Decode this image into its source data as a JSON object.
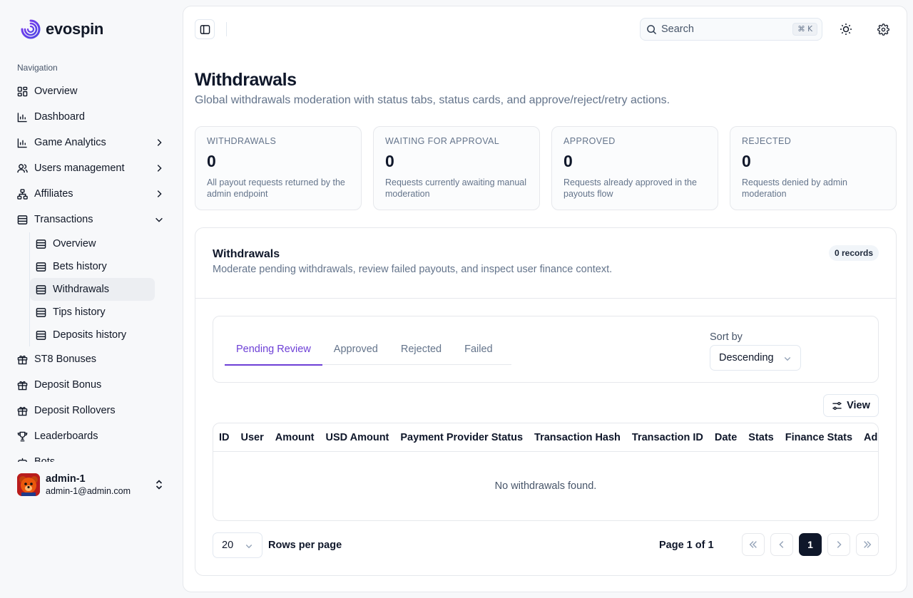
{
  "brand": {
    "name": "evospin"
  },
  "sidebar": {
    "heading": "Navigation",
    "items": [
      {
        "label": "Overview",
        "icon": "grid-icon"
      },
      {
        "label": "Dashboard",
        "icon": "chart-bar-icon"
      },
      {
        "label": "Game Analytics",
        "icon": "chart-bar-icon"
      },
      {
        "label": "Users management",
        "icon": "users-icon"
      },
      {
        "label": "Affiliates",
        "icon": "network-icon"
      },
      {
        "label": "Transactions",
        "icon": "archive-icon"
      }
    ],
    "sub_items": [
      {
        "label": "Overview"
      },
      {
        "label": "Bets history"
      },
      {
        "label": "Withdrawals"
      },
      {
        "label": "Tips history"
      },
      {
        "label": "Deposits history"
      }
    ],
    "more_items": [
      {
        "label": "ST8 Bonuses",
        "icon": "gift-icon"
      },
      {
        "label": "Deposit Bonus",
        "icon": "gift-icon"
      },
      {
        "label": "Deposit Rollovers",
        "icon": "gift-icon"
      },
      {
        "label": "Leaderboards",
        "icon": "trophy-icon"
      },
      {
        "label": "Bots",
        "icon": "bot-icon"
      }
    ],
    "user": {
      "name": "admin-1",
      "email": "admin-1@admin.com"
    }
  },
  "topbar": {
    "search_placeholder": "Search",
    "search_shortcut": "⌘ K"
  },
  "page": {
    "title": "Withdrawals",
    "description": "Global withdrawals moderation with status tabs, status cards, and approve/reject/retry actions."
  },
  "cards": [
    {
      "label": "WITHDRAWALS",
      "value": "0",
      "desc": "All payout requests returned by the admin endpoint"
    },
    {
      "label": "WAITING FOR APPROVAL",
      "value": "0",
      "desc": "Requests currently awaiting manual moderation"
    },
    {
      "label": "APPROVED",
      "value": "0",
      "desc": "Requests already approved in the payouts flow"
    },
    {
      "label": "REJECTED",
      "value": "0",
      "desc": "Requests denied by admin moderation"
    }
  ],
  "panel": {
    "title": "Withdrawals",
    "description": "Moderate pending withdrawals, review failed payouts, and inspect user finance context.",
    "records": "0 records",
    "tabs": [
      "Pending Review",
      "Approved",
      "Rejected",
      "Failed"
    ],
    "sort_label": "Sort by",
    "sort_value": "Descending",
    "view_label": "View",
    "columns": [
      "ID",
      "User",
      "Amount",
      "USD Amount",
      "Payment Provider Status",
      "Transaction Hash",
      "Transaction ID",
      "Date",
      "Stats",
      "Finance Stats",
      "Admin actions"
    ],
    "empty": "No withdrawals found.",
    "rows_per_page_value": "20",
    "rows_per_page_label": "Rows per page",
    "page_info": "Page 1 of 1",
    "current_page": "1"
  },
  "colors": {
    "accent": "#6d3fd6",
    "brand": "#5b3fd9",
    "dark": "#0f172a"
  }
}
